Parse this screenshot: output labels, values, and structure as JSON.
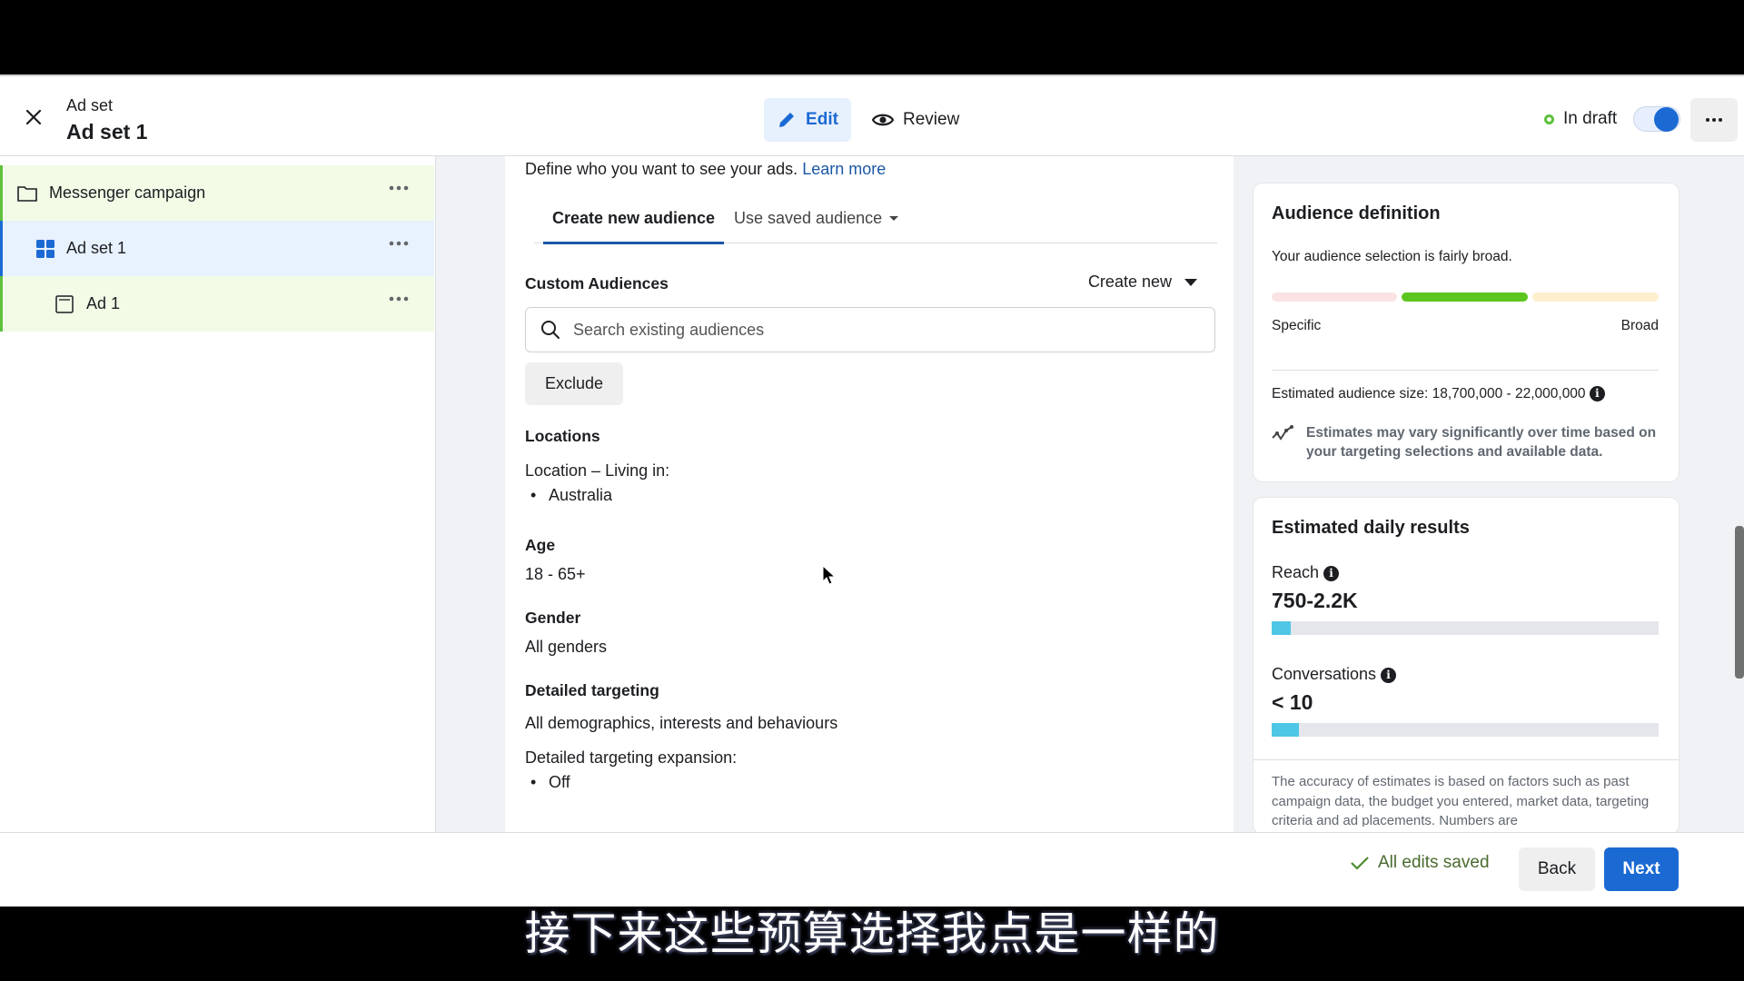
{
  "header": {
    "subtitle": "Ad set",
    "title": "Ad set 1",
    "modes": {
      "edit": "Edit",
      "review": "Review"
    },
    "status": "In draft",
    "toggle_on": true
  },
  "sidebar": {
    "items": [
      {
        "label": "Messenger campaign",
        "icon": "folder-icon",
        "active": false
      },
      {
        "label": "Ad set 1",
        "icon": "grid-icon",
        "active": true
      },
      {
        "label": "Ad 1",
        "icon": "ad-page-icon",
        "active": false
      }
    ]
  },
  "main": {
    "intro": "Define who you want to see your ads.",
    "learn_more": "Learn more",
    "tabs": [
      {
        "label": "Create new audience",
        "selected": true
      },
      {
        "label": "Use saved audience",
        "selected": false
      }
    ],
    "custom_audiences": {
      "label": "Custom Audiences",
      "create_new": "Create new",
      "search_placeholder": "Search existing audiences",
      "search_value": "",
      "exclude": "Exclude"
    },
    "locations": {
      "label": "Locations",
      "text": "Location – Living in:",
      "items": [
        "Australia"
      ]
    },
    "age": {
      "label": "Age",
      "value": "18 - 65+"
    },
    "gender": {
      "label": "Gender",
      "value": "All genders"
    },
    "detailed_targeting": {
      "label": "Detailed targeting",
      "value": "All demographics, interests and behaviours",
      "expansion_label": "Detailed targeting expansion:",
      "expansion_items": [
        "Off"
      ]
    }
  },
  "audience_definition": {
    "title": "Audience definition",
    "description": "Your audience selection is fairly broad.",
    "meter_level": "fairly broad",
    "meter_colors": [
      "#fbe3e4",
      "#5cc520",
      "#fdefcd"
    ],
    "specific_label": "Specific",
    "broad_label": "Broad",
    "size_text": "Estimated audience size: 18,700,000 - 22,000,000",
    "note": "Estimates may vary significantly over time based on your targeting selections and available data."
  },
  "daily_results": {
    "title": "Estimated daily results",
    "metrics": [
      {
        "label": "Reach",
        "value": "750-2.2K",
        "fill_percent": 5
      },
      {
        "label": "Conversations",
        "value": "< 10",
        "fill_percent": 7
      }
    ],
    "disclaimer": "The accuracy of estimates is based on factors such as past campaign data, the budget you entered, market data, targeting criteria and ad placements. Numbers are"
  },
  "footer": {
    "saved": "All edits saved",
    "back": "Back",
    "next": "Next"
  },
  "caption": "接下来这些预算选择我点是一样的",
  "colors": {
    "primary": "#1b6ad3",
    "status_green": "#5dc13c",
    "meter_active": "#5cc520",
    "bar_fill": "#4ec6e6"
  }
}
